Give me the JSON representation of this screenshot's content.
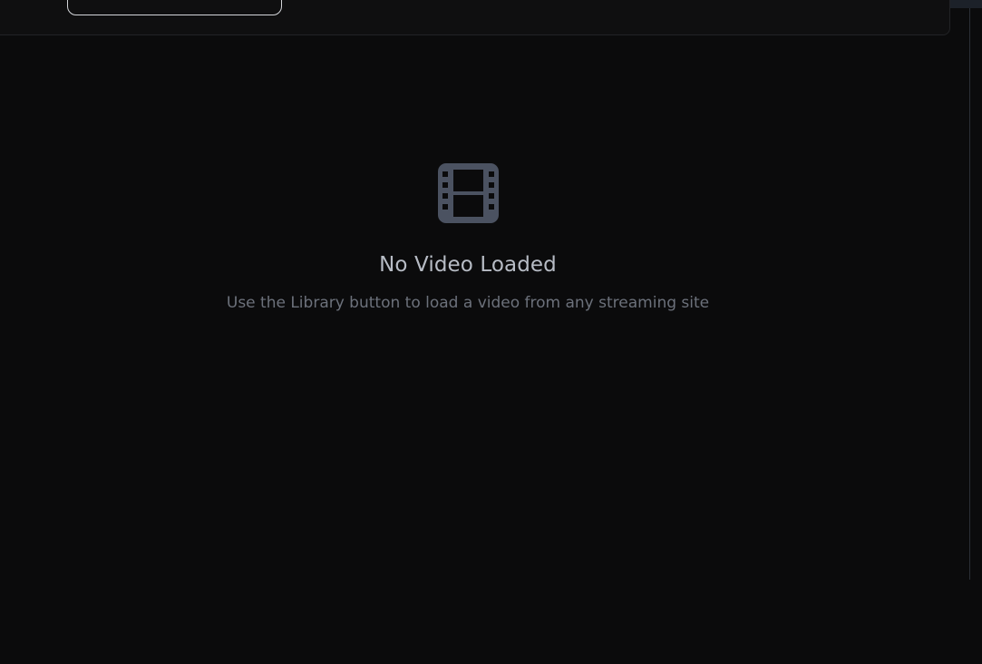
{
  "empty_state": {
    "icon": "film-icon",
    "title": "No Video Loaded",
    "subtitle": "Use the Library button to load a video from any streaming site"
  },
  "colors": {
    "background": "#0b0b0c",
    "icon": "#4b5261",
    "title": "#b7bcc5",
    "subtitle": "#6c717b"
  }
}
